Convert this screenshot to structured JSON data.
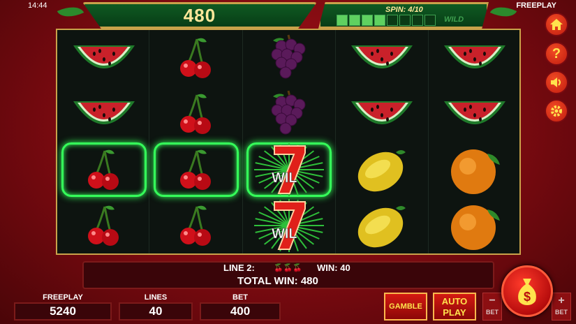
{
  "status": {
    "clock": "14:44",
    "mode": "FREEPLAY"
  },
  "top": {
    "win_amount": "480",
    "spin_label": "SPIN: 4/10",
    "spin_progress": 0.4,
    "wild_label": "WILD"
  },
  "colors": {
    "highlight": "#35ff5a",
    "gold": "#c9a24a",
    "panel_green": "#0f5a22",
    "button_red": "#d41a12"
  },
  "reels": [
    [
      "watermelon",
      "watermelon",
      "cherry",
      "cherry"
    ],
    [
      "cherry",
      "cherry",
      "cherry",
      "cherry"
    ],
    [
      "grapes",
      "grapes",
      "wild-seven",
      "wild-seven"
    ],
    [
      "watermelon",
      "watermelon",
      "lemon",
      "lemon"
    ],
    [
      "watermelon",
      "watermelon",
      "orange",
      "orange"
    ]
  ],
  "highlighted_cells": [
    [
      0,
      2
    ],
    [
      1,
      2
    ],
    [
      2,
      2
    ]
  ],
  "wild_text": "WIL",
  "side_icons": [
    "home-icon",
    "help-icon",
    "sound-icon",
    "settings-icon"
  ],
  "win_line": {
    "line_label": "LINE 2:",
    "symbols": "🍒🍒🍒",
    "win_label": "WIN: 40",
    "total_label": "TOTAL WIN: 480"
  },
  "stats": {
    "freeplay_label": "FREEPLAY",
    "freeplay_value": "5240",
    "lines_label": "LINES",
    "lines_value": "40",
    "bet_label": "BET",
    "bet_value": "400"
  },
  "buttons": {
    "gamble": "GAMBLE",
    "auto_line1": "AUTO",
    "auto_line2": "PLAY",
    "bet_minus_label": "BET",
    "bet_plus_label": "BET",
    "minus": "−",
    "plus": "+",
    "help": "?"
  }
}
